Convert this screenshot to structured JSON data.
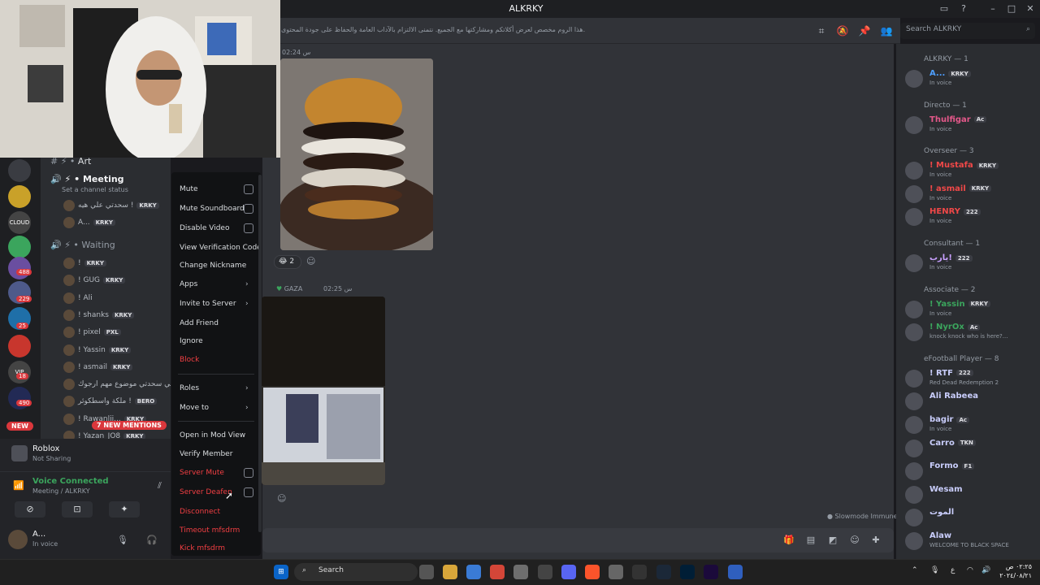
{
  "window": {
    "title": "ALKRKY"
  },
  "topic": "هذا الروم مخصص لعرض أكلاتكم ومشاركتها مع الجميع. نتمنى الالتزام بالآداب العامة والحفاظ على جودة المحتوى.",
  "search_placeholder": "Search ALKRKY",
  "server_rail": {
    "badges": [
      "488",
      "229",
      "25",
      "18",
      "490"
    ],
    "new_label": "NEW"
  },
  "channels": {
    "art": "Art",
    "meeting": "Meeting",
    "meeting_status": "Set a channel status",
    "waiting": "Waiting"
  },
  "voice_members_meeting": [
    {
      "name": "سحدتي علي هيه !",
      "tag": "KRKY"
    },
    {
      "name": "A...",
      "tag": "KRKY"
    }
  ],
  "voice_members_waiting": [
    {
      "name": "!",
      "tag": "KRKY"
    },
    {
      "name": "! GUG",
      "tag": "KRKY"
    },
    {
      "name": "! Ali",
      "tag": ""
    },
    {
      "name": "! shanks",
      "tag": "KRKY"
    },
    {
      "name": "! pixel",
      "tag": "PXL"
    },
    {
      "name": "! Yassin",
      "tag": "KRKY"
    },
    {
      "name": "! asmail",
      "tag": "KRKY"
    },
    {
      "name": "كركي سحدتي موضوع مهم ارجوك !",
      "tag": ""
    },
    {
      "name": "ملكة واسطكوئر !",
      "tag": "BERO"
    },
    {
      "name": "! Rawanlii...",
      "tag": "KRKY"
    },
    {
      "name": "! Yazan_JO8",
      "tag": "KRKY"
    }
  ],
  "mentions_label": "7 NEW MENTIONS",
  "activity": {
    "title": "Roblox",
    "subtitle": "Not Sharing"
  },
  "voice": {
    "status": "Voice Connected",
    "location": "Meeting / ALKRKY"
  },
  "user": {
    "name": "A...",
    "status": "In voice"
  },
  "context_menu": {
    "items": [
      {
        "label": "Mute",
        "kind": "check"
      },
      {
        "label": "Mute Soundboard",
        "kind": "check"
      },
      {
        "label": "Disable Video",
        "kind": "check"
      },
      {
        "label": "View Verification Code",
        "kind": "plain"
      },
      {
        "label": "Change Nickname",
        "kind": "plain"
      },
      {
        "label": "Apps",
        "kind": "submenu"
      },
      {
        "label": "Invite to Server",
        "kind": "submenu"
      },
      {
        "label": "Add Friend",
        "kind": "plain"
      },
      {
        "label": "Ignore",
        "kind": "plain"
      },
      {
        "label": "Block",
        "kind": "danger"
      },
      {
        "label": "Roles",
        "kind": "submenu"
      },
      {
        "label": "Move to",
        "kind": "submenu"
      },
      {
        "label": "Open in Mod View",
        "kind": "plain"
      },
      {
        "label": "Verify Member",
        "kind": "plain"
      },
      {
        "label": "Server Mute",
        "kind": "danger-check"
      },
      {
        "label": "Server Deafen",
        "kind": "danger-check"
      },
      {
        "label": "Disconnect",
        "kind": "danger"
      },
      {
        "label": "Timeout mfsdrm",
        "kind": "danger"
      },
      {
        "label": "Kick mfsdrm",
        "kind": "danger"
      }
    ]
  },
  "messages": {
    "time1": "س 02:24",
    "reaction_count": "2",
    "author2": "GAZA",
    "time2": "س 02:25"
  },
  "slowmode": "Slowmode Immune",
  "member_groups": [
    {
      "title": "ALKRKY — 1",
      "members": [
        {
          "name": "A...",
          "tag": "KRKY",
          "status": "In voice",
          "color": "#4e9fff"
        }
      ]
    },
    {
      "title": "Directo — 1",
      "members": [
        {
          "name": "Thulfigar",
          "tag": "Ac",
          "status": "In voice",
          "color": "#e4588a"
        }
      ]
    },
    {
      "title": "Overseer — 3",
      "members": [
        {
          "name": "! Mustafa",
          "tag": "KRKY",
          "status": "In voice",
          "color": "#f04848"
        },
        {
          "name": "! asmail",
          "tag": "KRKY",
          "status": "In voice",
          "color": "#f04848"
        },
        {
          "name": "HENRY",
          "tag": "222",
          "status": "In voice",
          "color": "#f04848"
        }
      ]
    },
    {
      "title": "Consultant — 1",
      "members": [
        {
          "name": "يارب!",
          "tag": "222",
          "status": "In voice",
          "color": "#c8a0ff"
        }
      ]
    },
    {
      "title": "Associate — 2",
      "members": [
        {
          "name": "! Yassin",
          "tag": "KRKY",
          "status": "In voice",
          "color": "#3ba55d"
        },
        {
          "name": "! NyrOx",
          "tag": "Ac",
          "status": "knock knock who is here?...",
          "color": "#3ba55d"
        }
      ]
    },
    {
      "title": "eFootball Player — 8",
      "members": [
        {
          "name": "! RTF",
          "tag": "222",
          "status": "Red Dead Redemption 2",
          "color": "#c9cdfb"
        },
        {
          "name": "Ali Rabeea",
          "tag": "",
          "status": "",
          "color": "#c9cdfb"
        },
        {
          "name": "bagir",
          "tag": "Ac",
          "status": "In voice",
          "color": "#c9cdfb"
        },
        {
          "name": "Carro",
          "tag": "TKN",
          "status": "",
          "color": "#c9cdfb"
        },
        {
          "name": "Formo",
          "tag": "F1",
          "status": "",
          "color": "#c9cdfb"
        },
        {
          "name": "Wesam",
          "tag": "",
          "status": "",
          "color": "#c9cdfb"
        },
        {
          "name": "الموت",
          "tag": "",
          "status": "",
          "color": "#c9cdfb"
        },
        {
          "name": "Alaw",
          "tag": "",
          "status": "WELCOME TO BLACK SPACE",
          "color": "#c9cdfb"
        }
      ]
    }
  ],
  "taskbar": {
    "search": "Search",
    "time": "٠٢:٢٥ ص",
    "date": "٢٠٢٤/٠٨/٢١",
    "lang": "ع"
  }
}
